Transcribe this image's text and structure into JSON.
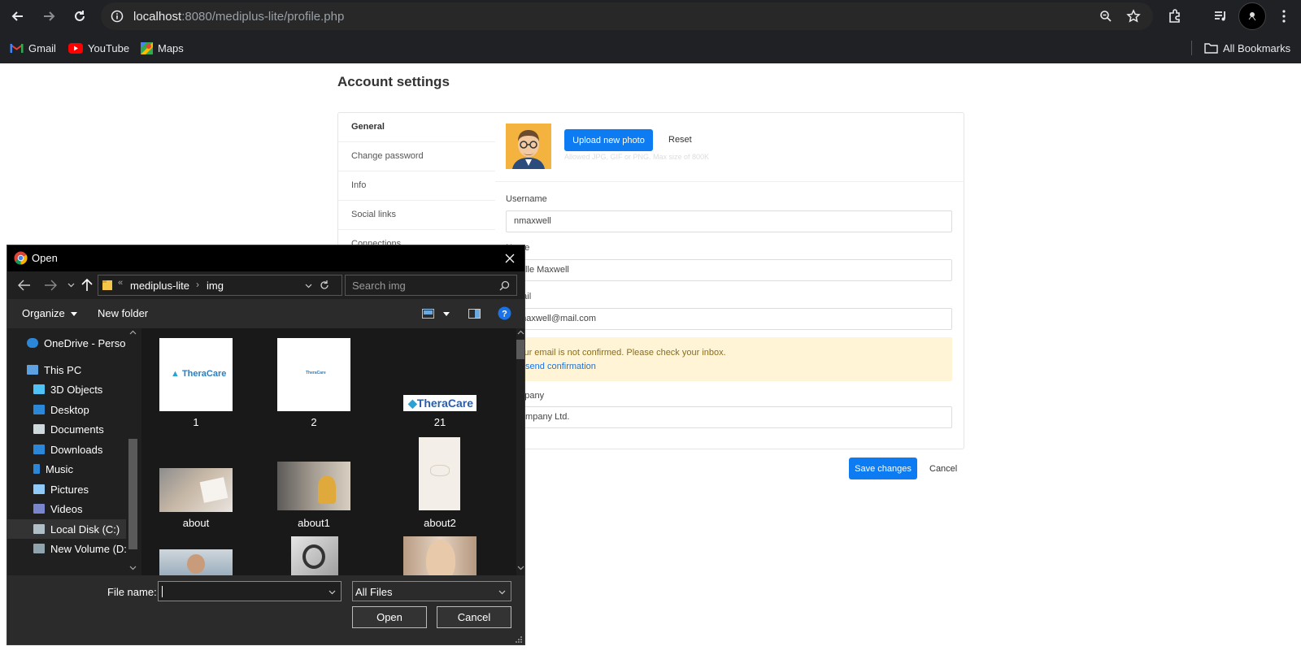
{
  "browser": {
    "url_host": "localhost",
    "url_path": ":8080/mediplus-lite/profile.php",
    "bookmarks": [
      "Gmail",
      "YouTube",
      "Maps"
    ],
    "all_bookmarks": "All Bookmarks"
  },
  "page": {
    "title": "Account settings",
    "tabs": [
      "General",
      "Change password",
      "Info",
      "Social links",
      "Connections"
    ],
    "upload_label": "Upload new photo",
    "reset_label": "Reset",
    "photo_hint": "Allowed JPG, GIF or PNG. Max size of 800K",
    "username_label": "Username",
    "username_value": "nmaxwell",
    "name_label": "Name",
    "name_value": "Nelle Maxwell",
    "email_label": "E-mail",
    "email_value": "nmaxwell@mail.com",
    "alert_text": "Your email is not confirmed. Please check your inbox.",
    "alert_link": "Resend confirmation",
    "company_label": "Company",
    "company_value": "Company Ltd.",
    "save_label": "Save changes",
    "cancel_label": "Cancel"
  },
  "dialog": {
    "title": "Open",
    "breadcrumb": [
      "mediplus-lite",
      "img"
    ],
    "search_placeholder": "Search img",
    "organize": "Organize",
    "new_folder": "New folder",
    "nav_items": [
      "OneDrive - Person",
      "This PC",
      "3D Objects",
      "Desktop",
      "Documents",
      "Downloads",
      "Music",
      "Pictures",
      "Videos",
      "Local Disk (C:)",
      "New Volume (D:)"
    ],
    "files": [
      "1",
      "2",
      "21",
      "about",
      "about1",
      "about2"
    ],
    "thumb_logo": "TheraCare",
    "file_name_label": "File name:",
    "file_name_value": "",
    "file_type": "All Files",
    "open_label": "Open",
    "cancel_label": "Cancel"
  }
}
